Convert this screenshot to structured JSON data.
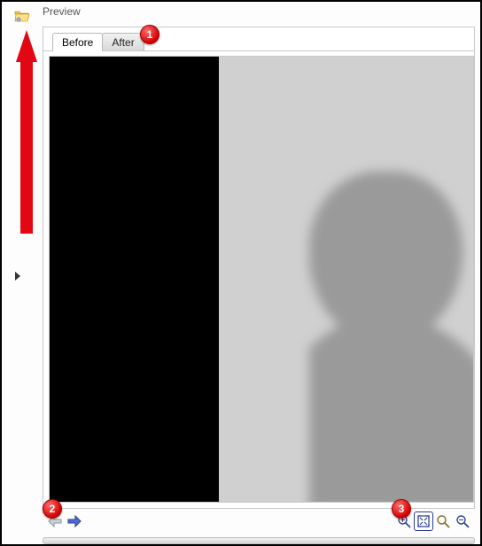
{
  "panel": {
    "title": "Preview"
  },
  "tabs": {
    "before": "Before",
    "after": "After",
    "active": "before"
  },
  "toolbar": {
    "prev": "prev-image",
    "next": "next-image",
    "zoom_in": "zoom-in",
    "fit": "fit-to-window",
    "zoom_100": "actual-size",
    "zoom_out": "zoom-out"
  },
  "markers": {
    "m1": "1",
    "m2": "2",
    "m3": "3"
  },
  "icons": {
    "folder": "folder-open-icon",
    "expand": "expand-panel-triangle"
  },
  "colors": {
    "annotation": "#e30613",
    "marker_border": "#9a0000"
  }
}
